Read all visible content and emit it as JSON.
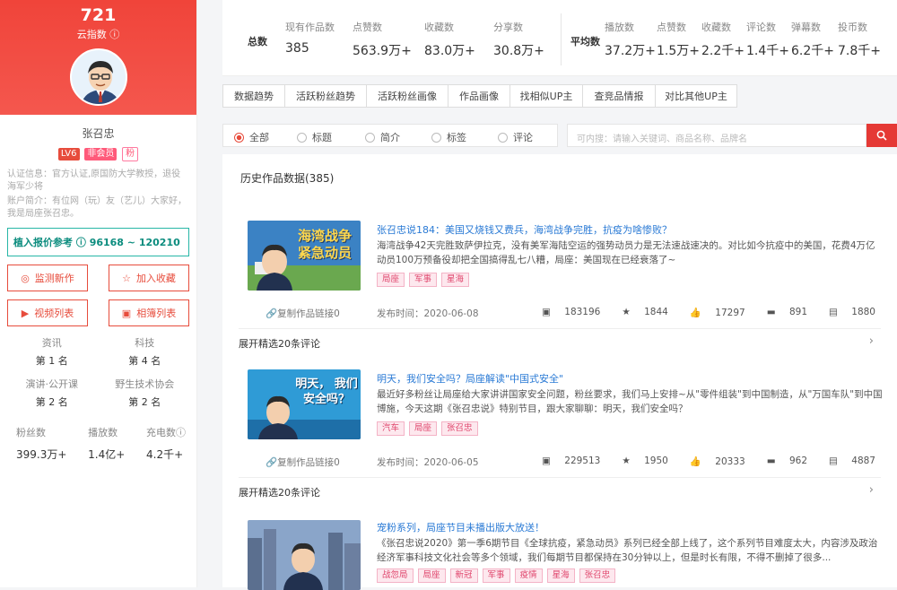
{
  "profile": {
    "index_value": "721",
    "index_label": "云指数",
    "name": "张召忠",
    "badge_level": "LV6",
    "badge_member": "非会员",
    "badge_fan": "粉",
    "verify": "认证信息：官方认证,原国防大学教授，退役海军少将",
    "bio": "账户简介：有位网（玩）友（艺儿）大家好，我是局座张召忠。",
    "quote_label": "植入报价参考",
    "quote_value": "96168 ~ 120210",
    "btn_monitor": "监测新作",
    "btn_collect": "加入收藏",
    "btn_videos": "视频列表",
    "btn_albums": "相簿列表",
    "ranks": [
      {
        "label": "资讯",
        "value": "第 1 名"
      },
      {
        "label": "科技",
        "value": "第 4 名"
      },
      {
        "label": "演讲·公开课",
        "value": "第 2 名"
      },
      {
        "label": "野生技术协会",
        "value": "第 2 名"
      }
    ],
    "stats": [
      {
        "label": "粉丝数",
        "value": "399.3万+"
      },
      {
        "label": "播放数",
        "value": "1.4亿+"
      },
      {
        "label": "充电数",
        "value": "4.2千+"
      }
    ]
  },
  "totals": {
    "label": "总数",
    "cols": [
      {
        "h": "现有作品数",
        "v": "385"
      },
      {
        "h": "点赞数",
        "v": "563.9万+"
      },
      {
        "h": "收藏数",
        "v": "83.0万+"
      },
      {
        "h": "分享数",
        "v": "30.8万+"
      }
    ]
  },
  "averages": {
    "label": "平均数",
    "cols": [
      {
        "h": "播放数",
        "v": "37.2万+"
      },
      {
        "h": "点赞数",
        "v": "1.5万+"
      },
      {
        "h": "收藏数",
        "v": "2.2千+"
      },
      {
        "h": "评论数",
        "v": "1.4千+"
      },
      {
        "h": "弹幕数",
        "v": "6.2千+"
      },
      {
        "h": "投币数",
        "v": "7.8千+"
      }
    ]
  },
  "tabs": [
    "数据趋势",
    "活跃粉丝趋势",
    "活跃粉丝画像",
    "作品画像",
    "找相似UP主",
    "查竞品情报",
    "对比其他UP主"
  ],
  "filters": [
    "全部",
    "标题",
    "简介",
    "标签",
    "评论"
  ],
  "search_placeholder": "可内搜：请输入关键词、商品名称、品牌名",
  "panel_title": "历史作品数据(385)",
  "items": [
    {
      "title": "张召忠说184：美国又烧钱又费兵，海湾战争完胜，抗疫为啥惨败？",
      "desc": "海湾战争42天完胜致萨伊拉克，没有美军海陆空运的强势动员力是无法速战速决的。对比如今抗疫中的美国，花费4万亿动员100万预备役却把全国搞得乱七八糟，局座：美国现在已经衰落了~",
      "thumb_text": "海湾战争 紧急动员",
      "tags": [
        "局座",
        "军事",
        "星海"
      ],
      "copy": "复制作品链接0",
      "date": "发布时间：2020-06-08",
      "plays": "183196",
      "coins": "1844",
      "likes": "17297",
      "comments": "891",
      "danmaku": "1880",
      "expand": "展开精选20条评论"
    },
    {
      "title": "明天，我们安全吗？局座解读\"中国式安全\"",
      "desc": "最近好多粉丝让局座给大家讲讲国家安全问题，粉丝要求，我们马上安排~从\"零件组装\"到中国制造，从\"万国车队\"到中国博施，今天这期《张召忠说》特别节目，跟大家聊聊：明天，我们安全吗？",
      "thumb_text": "明天， 我们安全吗？",
      "tags": [
        "汽车",
        "局座",
        "张召忠"
      ],
      "copy": "复制作品链接0",
      "date": "发布时间：2020-06-05",
      "plays": "229513",
      "coins": "1950",
      "likes": "20333",
      "comments": "962",
      "danmaku": "4887",
      "expand": "展开精选20条评论"
    },
    {
      "title": "宠粉系列，局座节目未播出版大放送！",
      "desc": "《张召忠说2020》第一季6期节目《全球抗疫，紧急动员》系列已经全部上线了，这个系列节目难度太大，内容涉及政治经济军事科技文化社会等多个领域，我们每期节目都保持在30分钟以上，但是时长有限，不得不删掉了很多...",
      "tags": [
        "战忽局",
        "局座",
        "新冠",
        "军事",
        "疫情",
        "星海",
        "张召忠"
      ]
    }
  ]
}
